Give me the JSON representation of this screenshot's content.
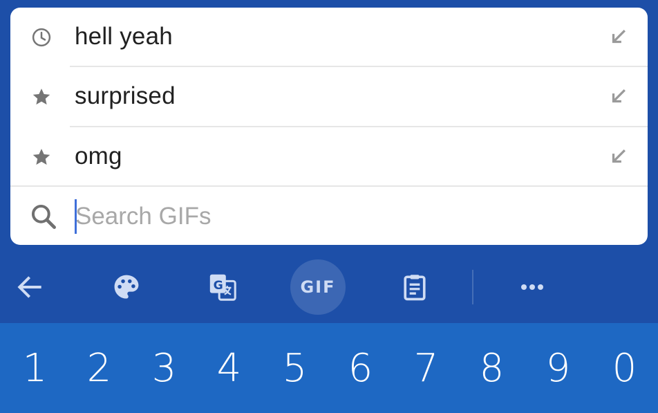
{
  "suggestions": [
    {
      "icon": "history-icon",
      "label": "hell yeah"
    },
    {
      "icon": "star-icon",
      "label": "surprised"
    },
    {
      "icon": "star-icon",
      "label": "omg"
    }
  ],
  "search": {
    "placeholder": "Search GIFs",
    "value": ""
  },
  "toolbar": {
    "items": [
      "back-arrow-icon",
      "palette-icon",
      "translate-icon",
      "gif",
      "clipboard-icon",
      "more-icon"
    ],
    "gif_label": "GIF"
  },
  "number_keys": [
    "1",
    "2",
    "3",
    "4",
    "5",
    "6",
    "7",
    "8",
    "9",
    "0"
  ],
  "colors": {
    "toolbar_bg": "#1d4fa8",
    "keyboard_bg": "#1e68c3",
    "panel_bg": "#ffffff",
    "caret": "#3f6fd9"
  }
}
